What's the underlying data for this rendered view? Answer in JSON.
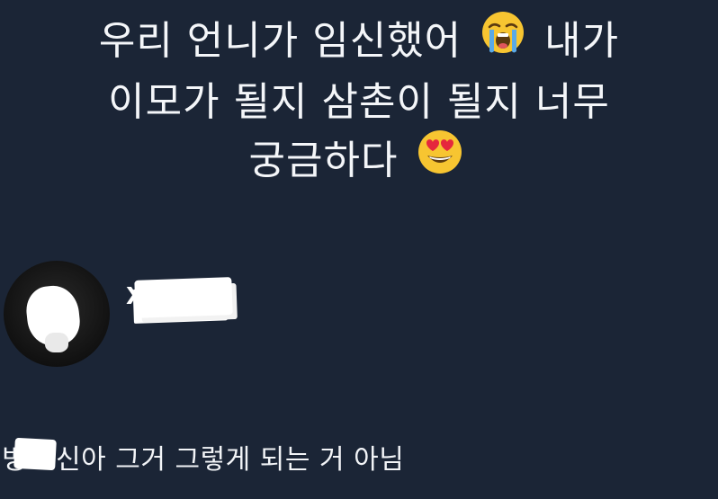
{
  "post": {
    "line1": "우리 언니가 임신했어",
    "line1_emoji": "loudly-crying-face-emoji",
    "line1_tail": "내가",
    "line2": "이모가 될지 삼촌이 될지 너무",
    "line3": "궁금하다",
    "line3_emoji": "smiling-face-with-heart-eyes-emoji"
  },
  "reply": {
    "handle": "X",
    "comment_prefix": "병",
    "comment_text": "신아 그거 그렇게 되는 거 아님"
  },
  "colors": {
    "background": "#1b2536",
    "text": "#f2f4f7",
    "emoji_yellow": "#f7c531"
  }
}
